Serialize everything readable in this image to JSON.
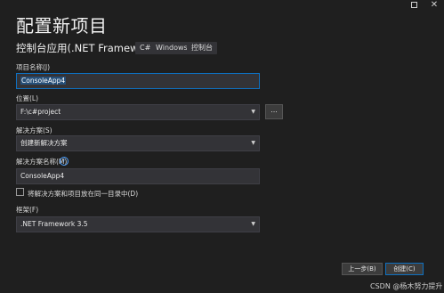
{
  "window": {
    "maximize_icon": "maximize-icon",
    "close_icon": "close-icon",
    "close_glyph": "✕"
  },
  "page": {
    "title": "配置新项目"
  },
  "template": {
    "name": ".NET Framework",
    "name_prefix": "控制台应用(",
    "name_suffix": ")",
    "tags": [
      "C#",
      "Windows",
      "控制台"
    ]
  },
  "form": {
    "project_name_label": "项目名称(J)",
    "project_name_value": "ConsoleApp4",
    "location_label": "位置(L)",
    "location_value": "F:\\c#project",
    "browse_label": "...",
    "solution_label": "解决方案(S)",
    "solution_value": "创建新解决方案",
    "solution_name_label": "解决方案名称(M)",
    "solution_name_value": "ConsoleApp4",
    "info_icon": "info-icon",
    "same_dir_label": "将解决方案和项目放在同一目录中(D)",
    "same_dir_checked": false,
    "framework_label": "框架(F)",
    "framework_value": ".NET Framework 3.5"
  },
  "footer": {
    "back_label": "上一步(B)",
    "create_label": "创建(C)"
  },
  "watermark": "CSDN @杨木努力提升",
  "colors": {
    "background": "#1f1f1f",
    "accent": "#0e70c0",
    "field": "#333337"
  }
}
